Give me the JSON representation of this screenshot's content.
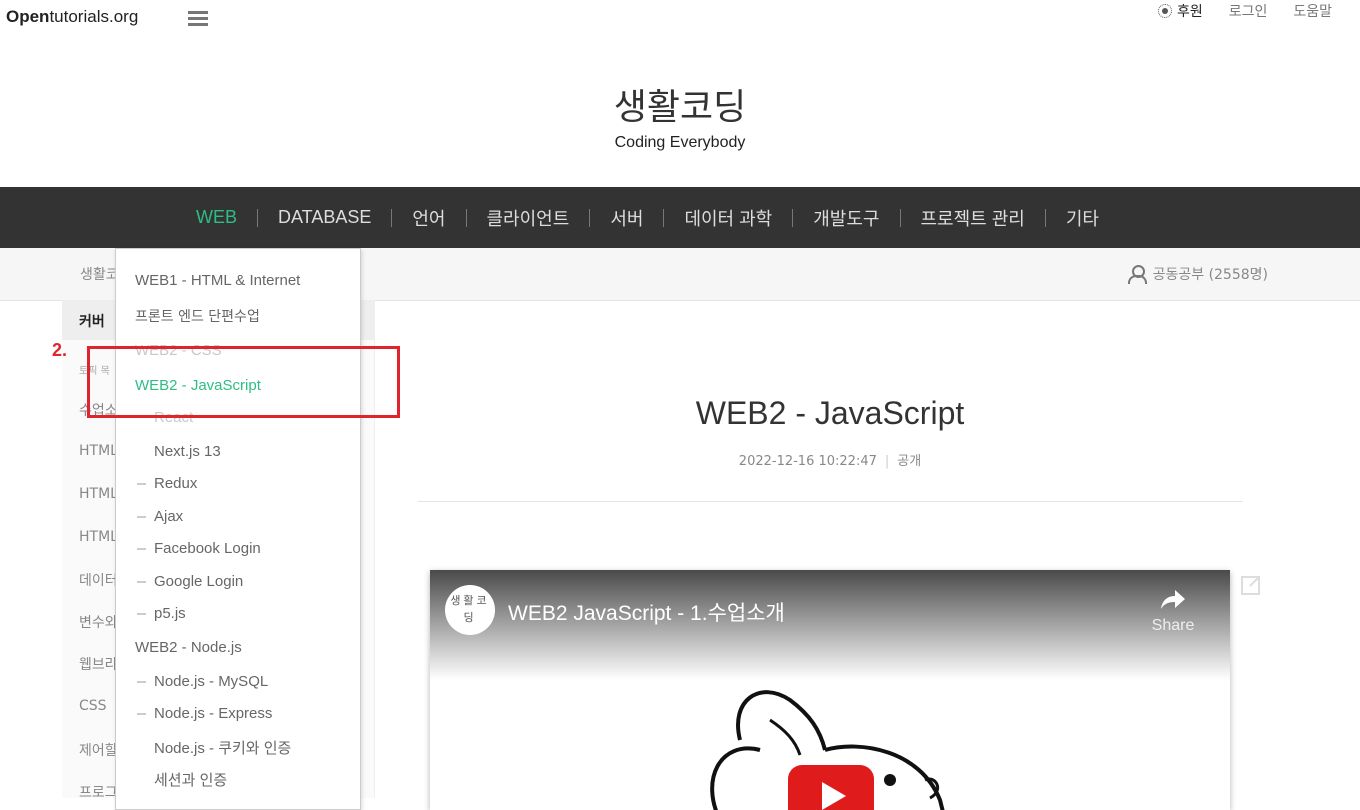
{
  "header": {
    "logo_bold": "Open",
    "logo_rest": "tutorials.org",
    "links": {
      "sponsor": "후원",
      "login": "로그인",
      "help": "도움말"
    }
  },
  "site": {
    "title": "생활코딩",
    "subtitle": "Coding Everybody"
  },
  "nav": {
    "items": [
      {
        "label": "WEB",
        "active": true
      },
      {
        "label": "DATABASE"
      },
      {
        "label": "언어"
      },
      {
        "label": "클라이언트"
      },
      {
        "label": "서버"
      },
      {
        "label": "데이터 과학"
      },
      {
        "label": "개발도구"
      },
      {
        "label": "프로젝트 관리"
      },
      {
        "label": "기타"
      }
    ]
  },
  "subbar": {
    "breadcrumb": "생활코",
    "study": "공동공부 (2558명)"
  },
  "sidebar": {
    "cover": "커버",
    "items": [
      "토픽 목",
      "수업소",
      "HTML",
      "HTML",
      "HTML",
      "데이터",
      "변수와",
      "웹브라",
      "CSS",
      "제어할",
      "프로그"
    ]
  },
  "dropdown": {
    "items": [
      "WEB1 - HTML & Internet",
      "프론트 엔드 단편수업",
      "WEB2 - CSS",
      "WEB2 - JavaScript",
      "React",
      "Next.js 13",
      "Redux",
      "Ajax",
      "Facebook Login",
      "Google Login",
      "p5.js",
      "WEB2 - Node.js",
      "Node.js - MySQL",
      "Node.js - Express",
      "Node.js - 쿠키와 인증",
      "세션과 인증"
    ]
  },
  "annotation": {
    "label": "2."
  },
  "article": {
    "title": "WEB2 - JavaScript",
    "date": "2022-12-16 10:22:47",
    "visibility": "공개"
  },
  "video": {
    "title": "WEB2 JavaScript - 1.수업소개",
    "share": "Share",
    "channel": "생활코딩"
  },
  "colors": {
    "accent": "#2ebd85",
    "nav_bg": "#333333",
    "annotation": "#e0242e"
  }
}
